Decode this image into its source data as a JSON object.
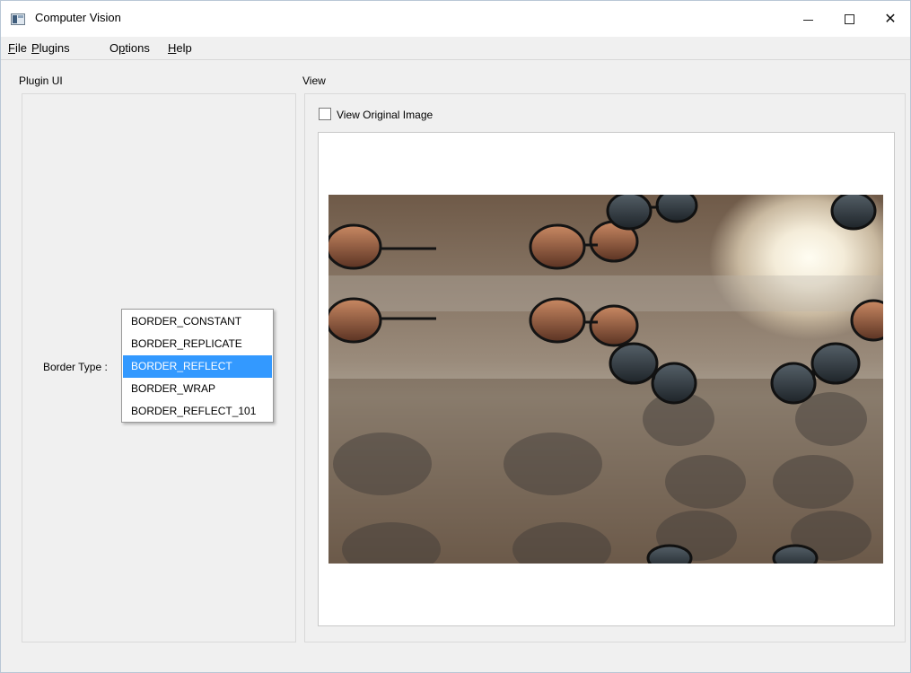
{
  "window": {
    "title": "Computer Vision"
  },
  "title_controls": {
    "minimize_icon": "minimize-icon",
    "maximize_icon": "maximize-icon",
    "close_icon": "close-icon"
  },
  "menu": [
    {
      "label": "File",
      "mnemonic": "F",
      "rest": "ile"
    },
    {
      "label": "Plugins",
      "mnemonic": "P",
      "rest": "lugins"
    },
    {
      "label": "Options",
      "mnemonic_prefix": "O",
      "mnemonic": "p",
      "rest": "tions"
    },
    {
      "label": "Help",
      "mnemonic": "H",
      "rest": "elp"
    }
  ],
  "plugin_panel": {
    "title": "Plugin UI",
    "border_type_label": "Border Type :",
    "border_type_options": [
      "BORDER_CONSTANT",
      "BORDER_REPLICATE",
      "BORDER_REFLECT",
      "BORDER_WRAP",
      "BORDER_REFLECT_101"
    ],
    "selected_option": "BORDER_REFLECT"
  },
  "view_panel": {
    "title": "View",
    "view_original_label": "View Original Image",
    "view_original_checked": false
  },
  "colors": {
    "selection": "#3399ff",
    "window_bg": "#f0f0f0",
    "panel_border": "#d9d9d9"
  }
}
